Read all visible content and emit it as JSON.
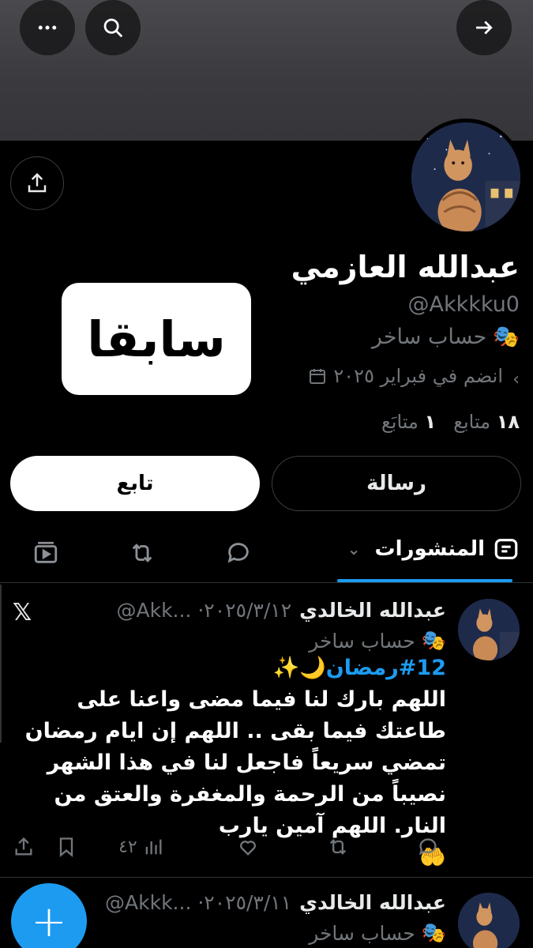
{
  "header": {
    "more_icon": "more-horizontal-icon",
    "search_icon": "search-icon",
    "forward_icon": "arrow-right-icon"
  },
  "profile": {
    "name": "عبدالله العازمي",
    "handle": "@Akkkku0",
    "badge_emoji": "🎭",
    "badge_text": "حساب ساخر",
    "joined": "انضم في فبراير ٢٠٢٥",
    "followers_count": "١٨",
    "followers_label": "متابع",
    "following_count": "١",
    "following_label": "متابَع"
  },
  "sticker": {
    "text": "سابقا"
  },
  "buttons": {
    "message": "رسالة",
    "follow": "تابع"
  },
  "tabs": {
    "active_label": "المنشورات"
  },
  "posts": [
    {
      "name": "عبدالله الخالدي",
      "meta": "@Akk... ·٢٠٢٥/٣/١٢",
      "badge_text": "حساب ساخر",
      "hashtag": "#12رمضان",
      "emoji_tail": "🌙✨",
      "body": "اللهم بارك لنا فيما مضى واعنا على طاعتك فيما بقى .. اللهم إن ايام رمضان تمضي سريعاً فاجعل لنا في هذا الشهر نصيباً من الرحمة والمغفرة والعتق من النار. اللهم آمين يارب",
      "body_emoji": "🤲",
      "views": "٤٢"
    },
    {
      "name": "عبدالله الخالدي",
      "meta": "@Akkk... ·٢٠٢٥/٣/١١",
      "badge_text": "حساب ساخر"
    }
  ],
  "colors": {
    "accent": "#1d9bf0",
    "background": "#000000",
    "muted_text": "#71767b",
    "border": "#2f3336"
  }
}
